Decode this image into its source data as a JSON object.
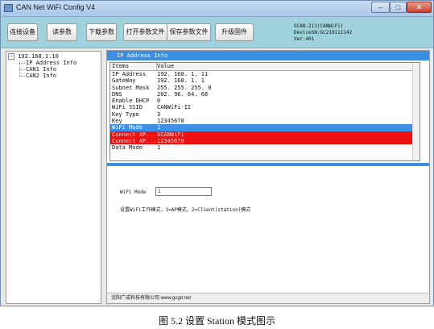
{
  "window": {
    "title": "CAN Net WiFi Config V4",
    "controls": {
      "minimize": "–",
      "maximize": "□",
      "close": "✕"
    }
  },
  "toolbar": {
    "buttons": [
      "连接设备",
      "读参数",
      "下载参数",
      "打开参数文件",
      "保存参数文件",
      "升级固件"
    ]
  },
  "device_info": {
    "model": "GCAN-211(CANWiFi)",
    "serial": "DeviceSN:GC219111142",
    "version": "Ver:401"
  },
  "tree": {
    "root": "192.168.1.10",
    "expander": "−",
    "children": [
      "IP Address Info",
      "CAN1 Info",
      "CAN2 Info"
    ]
  },
  "panel": {
    "header": "IP Address Info",
    "columns": [
      "Items",
      "Value"
    ],
    "rows": [
      {
        "item": "IP Address",
        "value": "192. 168. 1. 11"
      },
      {
        "item": "GateWay",
        "value": "192. 168. 1. 1"
      },
      {
        "item": "Subnet Mask",
        "value": "255. 255. 255. 0"
      },
      {
        "item": "DNS",
        "value": "202. 96. 64. 68"
      },
      {
        "item": "Enable DHCP",
        "value": "0"
      },
      {
        "item": "WiFi SSID",
        "value": "CANWiFi-II"
      },
      {
        "item": "Key Type",
        "value": "3"
      },
      {
        "item": "Key",
        "value": "12345678"
      },
      {
        "item": "WiFi Mode",
        "value": "1"
      },
      {
        "item": "Connect AP...",
        "value": "GCANWiFi"
      },
      {
        "item": "Connect AP...",
        "value": "12345678"
      },
      {
        "item": "Data Mode",
        "value": "1"
      }
    ],
    "selected_row": "WiFi Mode",
    "highlighted_rows": [
      "Connect AP..."
    ]
  },
  "editor": {
    "field_label": "WiFi Mode",
    "field_value": "1",
    "hint": "设置WiFi工作模式，1=AP模式，2=Client(station)模式"
  },
  "status_bar": {
    "text": "沈阳广成科技有限公司  www.gcgd.net"
  },
  "caption": "图 5.2  设置 Station 模式图示",
  "colors": {
    "toolbar": "#9fd2dc",
    "header": "#3b8ee0",
    "selected": "#3e8fe6",
    "highlight": "#ef1111"
  }
}
